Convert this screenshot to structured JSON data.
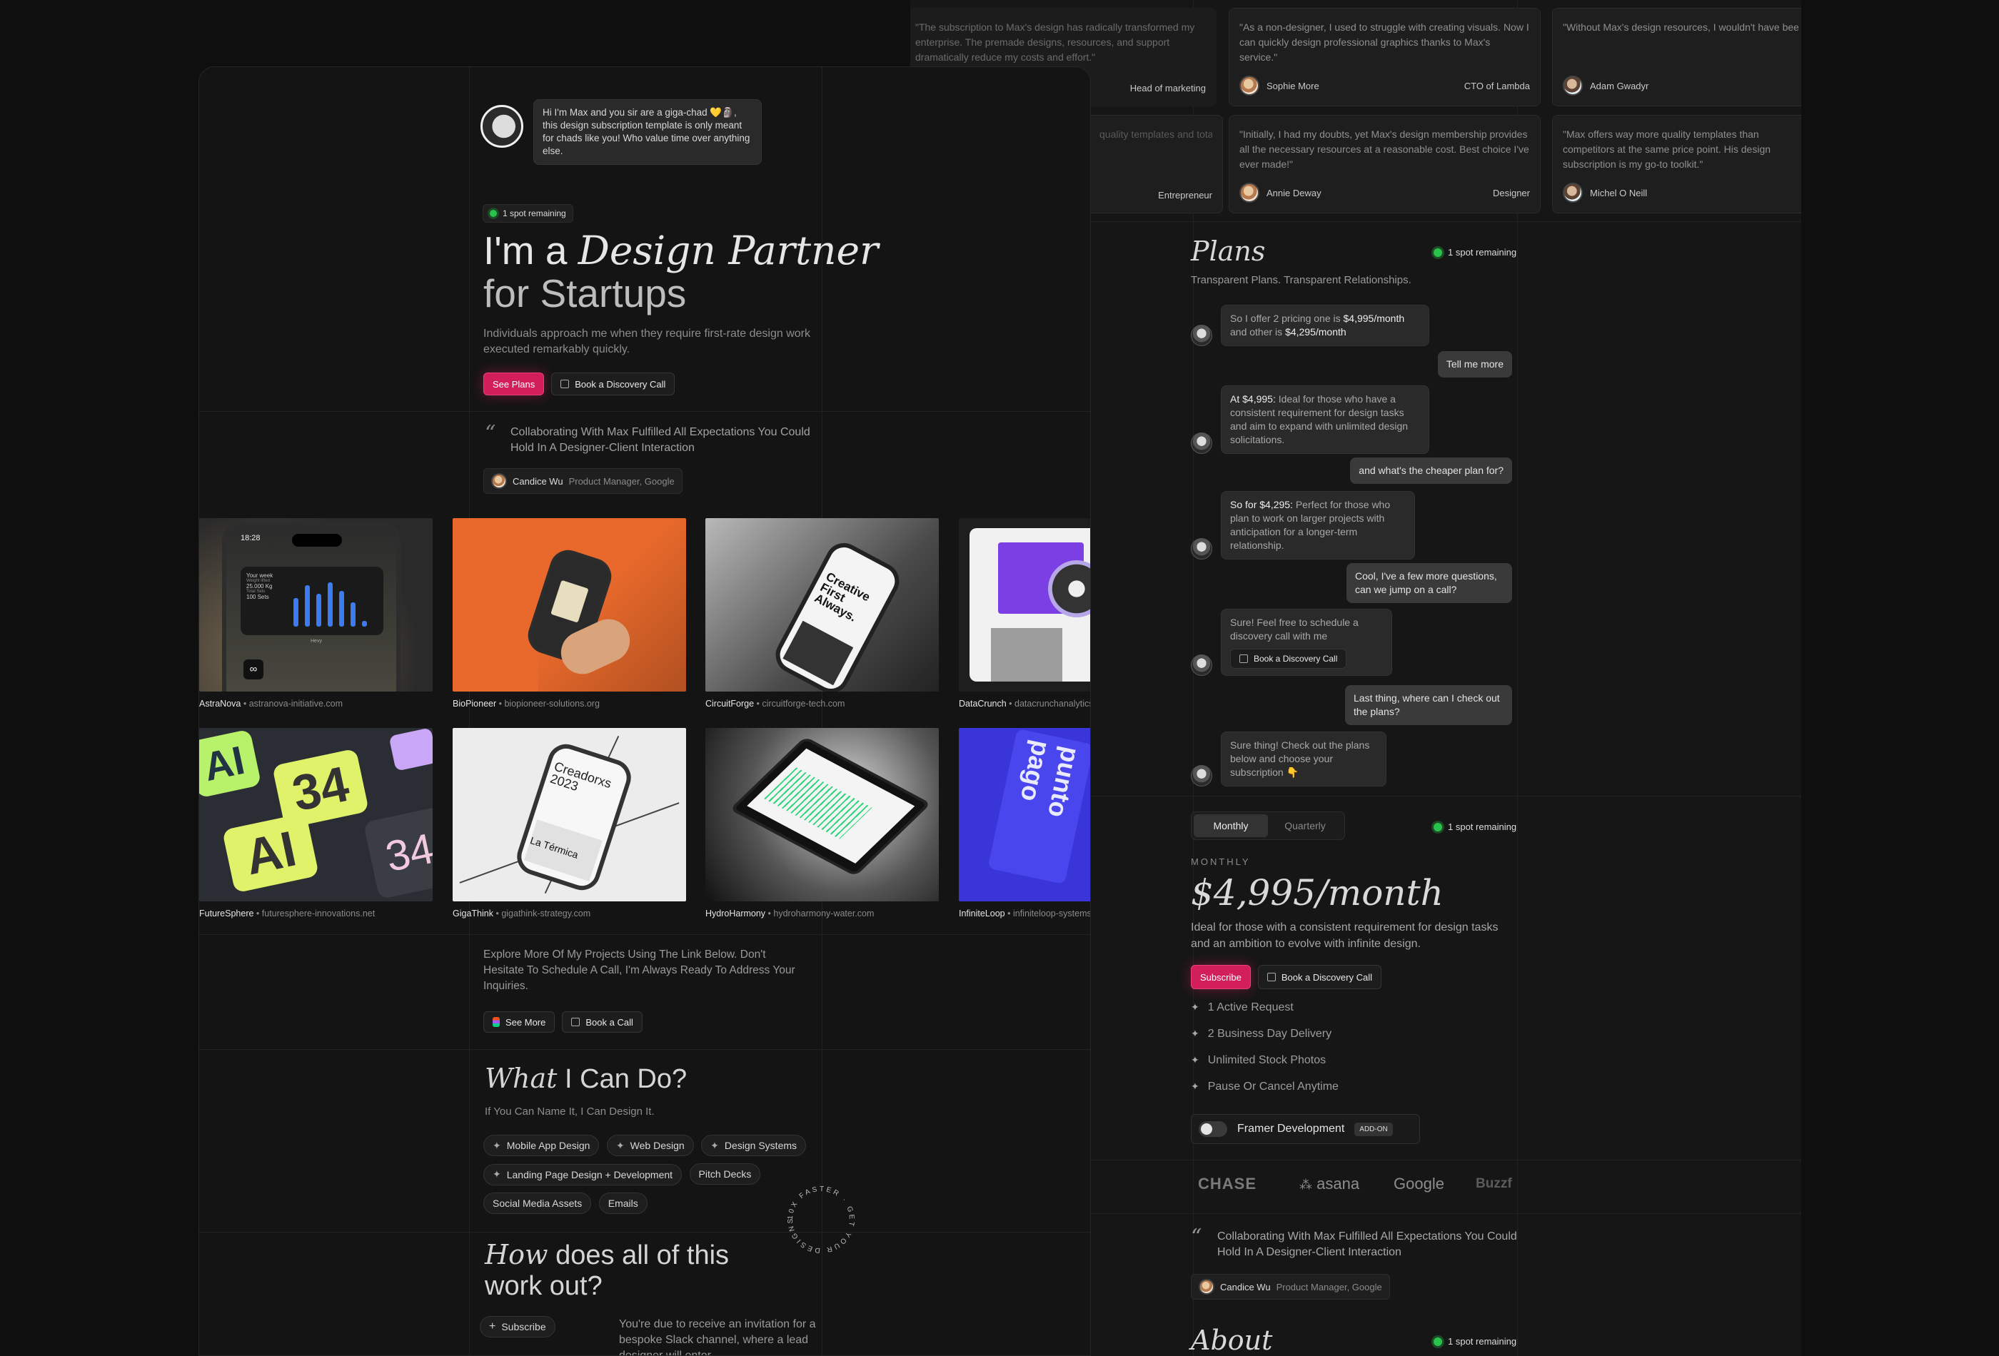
{
  "testimonials": [
    {
      "quote": "\"The subscription to Max's design has radically transformed my enterprise. The premade designs, resources, and support dramatically reduce my costs and effort.\"",
      "name": "",
      "role": "Head of marketing"
    },
    {
      "quote": "\"As a non-designer, I used to struggle with creating visuals. Now I can quickly design professional graphics thanks to Max's service.\"",
      "name": "Sophie More",
      "role": "CTO of Lambda"
    },
    {
      "quote": "\"Without Max's design resources, I wouldn't have been able to run my online shop as effectively. Since subscribing, our revenues increased by 20%.\"",
      "name": "Adam Gwadyr",
      "role": ""
    },
    {
      "quote": "quality templates and total designs to perfectly fit my",
      "name": "",
      "role": "Entrepreneur"
    },
    {
      "quote": "\"Initially, I had my doubts, yet Max's design membership provides all the necessary resources at a reasonable cost. Best choice I've ever made!\"",
      "name": "Annie Deway",
      "role": "Designer"
    },
    {
      "quote": "\"Max offers way more quality templates than competitors at the same price point. His design subscription is my go-to toolkit.\"",
      "name": "Michel O Neill",
      "role": ""
    }
  ],
  "plans": {
    "title": "Plans",
    "subtitle": "Transparent Plans. Transparent Relationships.",
    "spots": "1 spot remaining",
    "chat": {
      "m1a": "So I offer 2 pricing one is ",
      "m1b": "$4,995/month",
      "m1c": " and other is ",
      "m1d": "$4,295/month",
      "u1": "Tell me more",
      "m2a": "At $4,995:",
      "m2b": " Ideal for those who have a consistent requirement for design tasks and aim to expand with unlimited design solicitations.",
      "u2": "and what's the cheaper plan for?",
      "m3a": "So for $4,295:",
      "m3b": " Perfect for those who plan to work on larger projects with anticipation for a longer-term relationship.",
      "u3": "Cool, I've a few more questions, can we jump on a call?",
      "m4": "Sure! Feel free to schedule a discovery call with me",
      "m4btn": "Book a Discovery Call",
      "u4": "Last thing, where can I check out the plans?",
      "m5": "Sure thing! Check out the plans below and choose your subscription 👇"
    }
  },
  "pricing": {
    "tab_monthly": "Monthly",
    "tab_quarterly": "Quarterly",
    "period_label": "MONTHLY",
    "price": "$4,995/month",
    "desc": "Ideal for those with a consistent requirement for design tasks and an ambition to evolve with infinite design.",
    "subscribe": "Subscribe",
    "book": "Book a Discovery Call",
    "features": [
      "1 Active Request",
      "2 Business Day Delivery",
      "Unlimited Stock Photos",
      "Pause Or Cancel Anytime"
    ],
    "addon_label": "Framer Development",
    "addon_badge": "ADD-ON",
    "addon_on": 0
  },
  "logos": [
    "CHASE",
    "asana",
    "Google",
    "Buzzf"
  ],
  "quote2": {
    "text": "Collaborating With Max Fulfilled All Expectations You Could Hold In A Designer-Client Interaction",
    "name": "Candice Wu",
    "role": "Product Manager, Google"
  },
  "about": {
    "title": "About",
    "spots": "1 spot remaining"
  },
  "hero": {
    "greeting": "Hi I'm Max and you sir are a giga-chad 💛🗿, this design subscription template is only meant for chads like you! Who value time over anything else.",
    "spots": "1 spot remaining",
    "title_a": "I'm a ",
    "title_b": "Design Partner",
    "title_c": "for Startups",
    "sub": "Individuals approach me when they require first-rate design work executed remarkably quickly.",
    "see_plans": "See Plans",
    "book": "Book a Discovery Call",
    "quote": "Collaborating With Max Fulfilled All Expectations You Could Hold In A Designer-Client Interaction",
    "q_name": "Candice Wu",
    "q_role": "Product Manager, Google"
  },
  "projects": [
    {
      "name": "AstraNova",
      "url": "astranova-initiative.com"
    },
    {
      "name": "BioPioneer",
      "url": "biopioneer-solutions.org"
    },
    {
      "name": "CircuitForge",
      "url": "circuitforge-tech.com"
    },
    {
      "name": "DataCrunch",
      "url": "datacrunchanalytics.com"
    },
    {
      "name": "FutureSphere",
      "url": "futuresphere-innovations.net"
    },
    {
      "name": "GigaThink",
      "url": "gigathink-strategy.com"
    },
    {
      "name": "HydroHarmony",
      "url": "hydroharmony-water.com"
    },
    {
      "name": "InfiniteLoop",
      "url": "infiniteloop-systems.com"
    }
  ],
  "mockups": {
    "time": "18:28",
    "week": "Your week",
    "w1": "Weight lifted",
    "w2": "25.000 Kg",
    "w3": "Total Sets",
    "w4": "100 Sets",
    "hevy": "Hevy",
    "creative": "Creative First Always.",
    "creadorxs": "Creadorxs 2023",
    "termica": "La Térmica",
    "ai": "AI",
    "n34": "34",
    "punto": "punto pago"
  },
  "explore": {
    "text": "Explore More Of My Projects Using The Link Below. Don't Hesitate To Schedule A Call, I'm Always Ready To Address Your Inquiries.",
    "see_more": "See More",
    "book_call": "Book a Call"
  },
  "services": {
    "title_a": "What",
    "title_b": " I Can Do?",
    "sub": "If You Can Name It, I Can Design It.",
    "chips": [
      "Mobile App Design",
      "Web Design",
      "Design Systems",
      "Landing Page Design + Development",
      "Pitch Decks",
      "Social Media Assets",
      "Emails"
    ]
  },
  "how": {
    "title_a": "How",
    "title_b": " does all of this work out?",
    "subscribe": "Subscribe",
    "text": "You're due to receive an invitation for a bespoke Slack channel, where a lead designer will enter"
  },
  "circle_text": "10X FASTER · GET YOUR DESIGNS"
}
